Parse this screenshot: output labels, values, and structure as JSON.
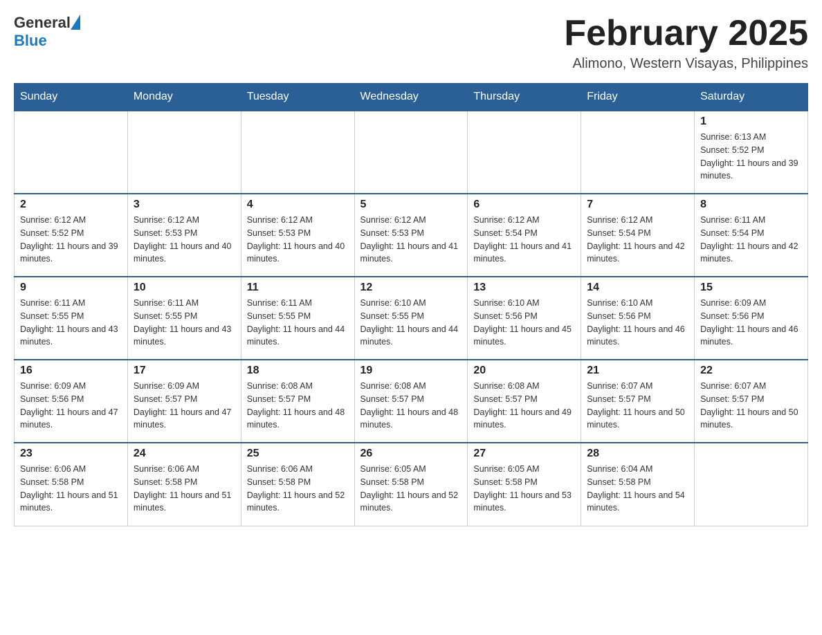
{
  "header": {
    "logo_general": "General",
    "logo_blue": "Blue",
    "month_title": "February 2025",
    "location": "Alimono, Western Visayas, Philippines"
  },
  "days_of_week": [
    "Sunday",
    "Monday",
    "Tuesday",
    "Wednesday",
    "Thursday",
    "Friday",
    "Saturday"
  ],
  "weeks": [
    [
      {
        "day": "",
        "sunrise": "",
        "sunset": "",
        "daylight": ""
      },
      {
        "day": "",
        "sunrise": "",
        "sunset": "",
        "daylight": ""
      },
      {
        "day": "",
        "sunrise": "",
        "sunset": "",
        "daylight": ""
      },
      {
        "day": "",
        "sunrise": "",
        "sunset": "",
        "daylight": ""
      },
      {
        "day": "",
        "sunrise": "",
        "sunset": "",
        "daylight": ""
      },
      {
        "day": "",
        "sunrise": "",
        "sunset": "",
        "daylight": ""
      },
      {
        "day": "1",
        "sunrise": "Sunrise: 6:13 AM",
        "sunset": "Sunset: 5:52 PM",
        "daylight": "Daylight: 11 hours and 39 minutes."
      }
    ],
    [
      {
        "day": "2",
        "sunrise": "Sunrise: 6:12 AM",
        "sunset": "Sunset: 5:52 PM",
        "daylight": "Daylight: 11 hours and 39 minutes."
      },
      {
        "day": "3",
        "sunrise": "Sunrise: 6:12 AM",
        "sunset": "Sunset: 5:53 PM",
        "daylight": "Daylight: 11 hours and 40 minutes."
      },
      {
        "day": "4",
        "sunrise": "Sunrise: 6:12 AM",
        "sunset": "Sunset: 5:53 PM",
        "daylight": "Daylight: 11 hours and 40 minutes."
      },
      {
        "day": "5",
        "sunrise": "Sunrise: 6:12 AM",
        "sunset": "Sunset: 5:53 PM",
        "daylight": "Daylight: 11 hours and 41 minutes."
      },
      {
        "day": "6",
        "sunrise": "Sunrise: 6:12 AM",
        "sunset": "Sunset: 5:54 PM",
        "daylight": "Daylight: 11 hours and 41 minutes."
      },
      {
        "day": "7",
        "sunrise": "Sunrise: 6:12 AM",
        "sunset": "Sunset: 5:54 PM",
        "daylight": "Daylight: 11 hours and 42 minutes."
      },
      {
        "day": "8",
        "sunrise": "Sunrise: 6:11 AM",
        "sunset": "Sunset: 5:54 PM",
        "daylight": "Daylight: 11 hours and 42 minutes."
      }
    ],
    [
      {
        "day": "9",
        "sunrise": "Sunrise: 6:11 AM",
        "sunset": "Sunset: 5:55 PM",
        "daylight": "Daylight: 11 hours and 43 minutes."
      },
      {
        "day": "10",
        "sunrise": "Sunrise: 6:11 AM",
        "sunset": "Sunset: 5:55 PM",
        "daylight": "Daylight: 11 hours and 43 minutes."
      },
      {
        "day": "11",
        "sunrise": "Sunrise: 6:11 AM",
        "sunset": "Sunset: 5:55 PM",
        "daylight": "Daylight: 11 hours and 44 minutes."
      },
      {
        "day": "12",
        "sunrise": "Sunrise: 6:10 AM",
        "sunset": "Sunset: 5:55 PM",
        "daylight": "Daylight: 11 hours and 44 minutes."
      },
      {
        "day": "13",
        "sunrise": "Sunrise: 6:10 AM",
        "sunset": "Sunset: 5:56 PM",
        "daylight": "Daylight: 11 hours and 45 minutes."
      },
      {
        "day": "14",
        "sunrise": "Sunrise: 6:10 AM",
        "sunset": "Sunset: 5:56 PM",
        "daylight": "Daylight: 11 hours and 46 minutes."
      },
      {
        "day": "15",
        "sunrise": "Sunrise: 6:09 AM",
        "sunset": "Sunset: 5:56 PM",
        "daylight": "Daylight: 11 hours and 46 minutes."
      }
    ],
    [
      {
        "day": "16",
        "sunrise": "Sunrise: 6:09 AM",
        "sunset": "Sunset: 5:56 PM",
        "daylight": "Daylight: 11 hours and 47 minutes."
      },
      {
        "day": "17",
        "sunrise": "Sunrise: 6:09 AM",
        "sunset": "Sunset: 5:57 PM",
        "daylight": "Daylight: 11 hours and 47 minutes."
      },
      {
        "day": "18",
        "sunrise": "Sunrise: 6:08 AM",
        "sunset": "Sunset: 5:57 PM",
        "daylight": "Daylight: 11 hours and 48 minutes."
      },
      {
        "day": "19",
        "sunrise": "Sunrise: 6:08 AM",
        "sunset": "Sunset: 5:57 PM",
        "daylight": "Daylight: 11 hours and 48 minutes."
      },
      {
        "day": "20",
        "sunrise": "Sunrise: 6:08 AM",
        "sunset": "Sunset: 5:57 PM",
        "daylight": "Daylight: 11 hours and 49 minutes."
      },
      {
        "day": "21",
        "sunrise": "Sunrise: 6:07 AM",
        "sunset": "Sunset: 5:57 PM",
        "daylight": "Daylight: 11 hours and 50 minutes."
      },
      {
        "day": "22",
        "sunrise": "Sunrise: 6:07 AM",
        "sunset": "Sunset: 5:57 PM",
        "daylight": "Daylight: 11 hours and 50 minutes."
      }
    ],
    [
      {
        "day": "23",
        "sunrise": "Sunrise: 6:06 AM",
        "sunset": "Sunset: 5:58 PM",
        "daylight": "Daylight: 11 hours and 51 minutes."
      },
      {
        "day": "24",
        "sunrise": "Sunrise: 6:06 AM",
        "sunset": "Sunset: 5:58 PM",
        "daylight": "Daylight: 11 hours and 51 minutes."
      },
      {
        "day": "25",
        "sunrise": "Sunrise: 6:06 AM",
        "sunset": "Sunset: 5:58 PM",
        "daylight": "Daylight: 11 hours and 52 minutes."
      },
      {
        "day": "26",
        "sunrise": "Sunrise: 6:05 AM",
        "sunset": "Sunset: 5:58 PM",
        "daylight": "Daylight: 11 hours and 52 minutes."
      },
      {
        "day": "27",
        "sunrise": "Sunrise: 6:05 AM",
        "sunset": "Sunset: 5:58 PM",
        "daylight": "Daylight: 11 hours and 53 minutes."
      },
      {
        "day": "28",
        "sunrise": "Sunrise: 6:04 AM",
        "sunset": "Sunset: 5:58 PM",
        "daylight": "Daylight: 11 hours and 54 minutes."
      },
      {
        "day": "",
        "sunrise": "",
        "sunset": "",
        "daylight": ""
      }
    ]
  ]
}
